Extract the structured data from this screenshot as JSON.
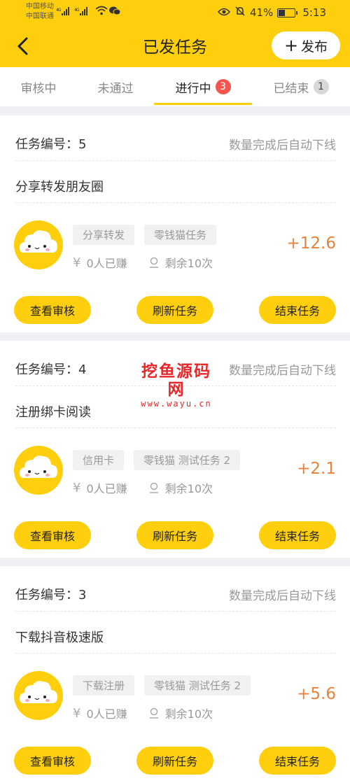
{
  "status_bar": {
    "carrier1": "中国移动",
    "carrier2": "中国联通",
    "battery_percent": "41%",
    "time": "5:13",
    "icons": [
      "signal-4g-icon",
      "wifi-icon",
      "wechat-icon",
      "eye-icon",
      "mute-bell-icon",
      "battery-icon"
    ]
  },
  "header": {
    "title": "已发任务",
    "publish_label": "发布",
    "publish_plus": "+"
  },
  "tabs": [
    {
      "label": "审核中"
    },
    {
      "label": "未通过"
    },
    {
      "label": "进行中",
      "badge": "3"
    },
    {
      "label": "已结束",
      "badge": "1"
    }
  ],
  "tasks": [
    {
      "number_label": "任务编号：5",
      "auto_offline": "数量完成后自动下线",
      "title": "分享转发朋友圈",
      "tags": [
        "分享转发",
        "零钱猫任务"
      ],
      "earned": "0人已赚",
      "remaining": "剩余10次",
      "reward": "+12.6",
      "buttons": [
        "查看审核",
        "刷新任务",
        "结束任务"
      ]
    },
    {
      "number_label": "任务编号：4",
      "auto_offline": "数量完成后自动下线",
      "title": "注册绑卡阅读",
      "tags": [
        "信用卡",
        "零钱猫 测试任务 2"
      ],
      "earned": "0人已赚",
      "remaining": "剩余10次",
      "reward": "+2.1",
      "buttons": [
        "查看审核",
        "刷新任务",
        "结束任务"
      ]
    },
    {
      "number_label": "任务编号：3",
      "auto_offline": "数量完成后自动下线",
      "title": "下载抖音极速版",
      "tags": [
        "下载注册",
        "零钱猫 测试任务 2"
      ],
      "earned": "0人已赚",
      "remaining": "剩余10次",
      "reward": "+5.6",
      "buttons": [
        "查看审核",
        "刷新任务",
        "结束任务"
      ]
    }
  ],
  "watermark": {
    "text": "挖鱼源码网",
    "url": "www.wayu.cn"
  },
  "colors": {
    "brand_yellow": "#ffcf0d",
    "reward_orange": "#e8823a",
    "badge_red": "#f4564f",
    "watermark_red": "#e8272a"
  }
}
